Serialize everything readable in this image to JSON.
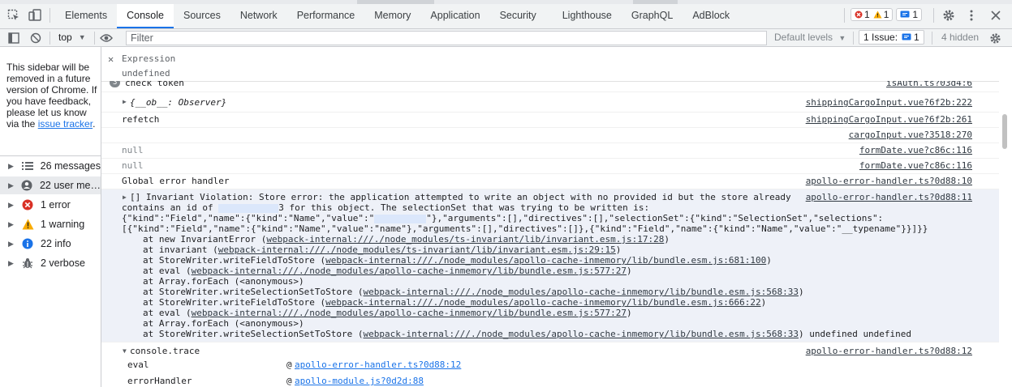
{
  "tabs": [
    "Elements",
    "Console",
    "Sources",
    "Network",
    "Performance",
    "Memory",
    "Application",
    "Security",
    "Lighthouse",
    "GraphQL",
    "AdBlock"
  ],
  "active_tab": "Console",
  "counters": {
    "errors": "1",
    "warnings": "1",
    "issues": "1"
  },
  "toolbar": {
    "context": "top",
    "filter_placeholder": "Filter",
    "levels": "Default levels",
    "issues_label": "1 Issue:",
    "issues_count": "1",
    "hidden": "4 hidden"
  },
  "sidebar": {
    "note": "This sidebar will be removed in a future version of Chrome. If you have feedback, please let us know via the",
    "link": "issue tracker",
    "note_end": ".",
    "items": [
      {
        "label": "26 messages",
        "icon": "list-icon"
      },
      {
        "label": "22 user me…",
        "icon": "user-icon"
      },
      {
        "label": "1 error",
        "icon": "error-icon"
      },
      {
        "label": "1 warning",
        "icon": "warning-icon"
      },
      {
        "label": "22 info",
        "icon": "info-icon"
      },
      {
        "label": "2 verbose",
        "icon": "bug-icon"
      }
    ]
  },
  "expression": {
    "label": "Expression",
    "value": "undefined"
  },
  "rows": {
    "r0": {
      "count": "3",
      "msg": "check token",
      "src": "isAuth.ts?03d4:6"
    },
    "r1": {
      "msg": "{__ob__: Observer}",
      "src": "shippingCargoInput.vue?6f2b:222"
    },
    "r2": {
      "msg": "refetch",
      "src": "shippingCargoInput.vue?6f2b:261"
    },
    "r3": {
      "msg": "",
      "src": "cargoInput.vue?3518:270"
    },
    "r4": {
      "msg": "null",
      "src": "formDate.vue?c86c:116"
    },
    "r5": {
      "msg": "null",
      "src": "formDate.vue?c86c:116"
    },
    "r6": {
      "msg": "Global error handler",
      "src": "apollo-error-handler.ts?0d88:10"
    }
  },
  "error": {
    "src": "apollo-error-handler.ts?0d88:11",
    "line1": "[] Invariant Violation: Store error: the application attempted to write an object with no provided id but the store already",
    "line2a": "contains an id of ",
    "line2b": "3 for this object. The selectionSet that was trying to be written is:",
    "line3a": "{\"kind\":\"Field\",\"name\":{\"kind\":\"Name\",\"value\":\"",
    "line3b": "\"},\"arguments\":[],\"directives\":[],\"selectionSet\":{\"kind\":\"SelectionSet\",\"selections\":",
    "line4": "[{\"kind\":\"Field\",\"name\":{\"kind\":\"Name\",\"value\":\"name\"},\"arguments\":[],\"directives\":[]},{\"kind\":\"Field\",\"name\":{\"kind\":\"Name\",\"value\":\"__typename\"}}]}}",
    "stack": [
      {
        "pre": "at new InvariantError (",
        "link": "webpack-internal:///./node_modules/ts-invariant/lib/invariant.esm.js:17:28",
        "post": ")"
      },
      {
        "pre": "at invariant (",
        "link": "webpack-internal:///./node_modules/ts-invariant/lib/invariant.esm.js:29:15",
        "post": ")"
      },
      {
        "pre": "at StoreWriter.writeFieldToStore (",
        "link": "webpack-internal:///./node_modules/apollo-cache-inmemory/lib/bundle.esm.js:681:100",
        "post": ")"
      },
      {
        "pre": "at eval (",
        "link": "webpack-internal:///./node_modules/apollo-cache-inmemory/lib/bundle.esm.js:577:27",
        "post": ")"
      },
      {
        "pre": "at Array.forEach (<anonymous>)",
        "link": "",
        "post": ""
      },
      {
        "pre": "at StoreWriter.writeSelectionSetToStore (",
        "link": "webpack-internal:///./node_modules/apollo-cache-inmemory/lib/bundle.esm.js:568:33",
        "post": ")"
      },
      {
        "pre": "at StoreWriter.writeFieldToStore (",
        "link": "webpack-internal:///./node_modules/apollo-cache-inmemory/lib/bundle.esm.js:666:22",
        "post": ")"
      },
      {
        "pre": "at eval (",
        "link": "webpack-internal:///./node_modules/apollo-cache-inmemory/lib/bundle.esm.js:577:27",
        "post": ")"
      },
      {
        "pre": "at Array.forEach (<anonymous>)",
        "link": "",
        "post": ""
      },
      {
        "pre": "at StoreWriter.writeSelectionSetToStore (",
        "link": "webpack-internal:///./node_modules/apollo-cache-inmemory/lib/bundle.esm.js:568:33",
        "post": ") undefined undefined"
      }
    ]
  },
  "trace": {
    "label": "console.trace",
    "src": "apollo-error-handler.ts?0d88:12",
    "frames": [
      {
        "fn": "eval",
        "at": "@",
        "link": "apollo-error-handler.ts?0d88:12"
      },
      {
        "fn": "errorHandler",
        "at": "@",
        "link": "apollo-module.js?0d2d:88"
      }
    ]
  },
  "colors": {
    "accent": "#1a73e8",
    "error": "#d93025",
    "warning": "#f9ab00"
  }
}
